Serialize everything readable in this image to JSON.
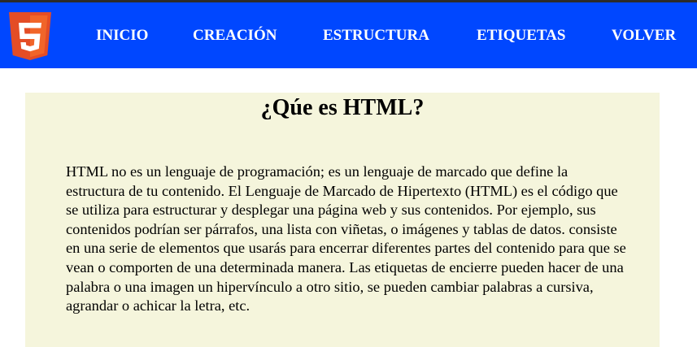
{
  "header": {
    "logo_icon": "html5-logo-icon",
    "logo_text": "5",
    "nav": [
      {
        "label": "INICIO"
      },
      {
        "label": "CREACIÓN"
      },
      {
        "label": "ESTRUCTURA"
      },
      {
        "label": "ETIQUETAS"
      },
      {
        "label": "VOLVER"
      }
    ]
  },
  "main": {
    "title": "¿Qúe es HTML?",
    "paragraph": "HTML no es un lenguaje de programación; es un lenguaje de marcado que define la estructura de tu contenido. El Lenguaje de Marcado de Hipertexto (HTML) es el código que se utiliza para estructurar y desplegar una página web y sus contenidos. Por ejemplo, sus contenidos podrían ser párrafos, una lista con viñetas, o imágenes y tablas de datos. consiste en una serie de elementos que usarás para encerrar diferentes partes del contenido para que se vean o comporten de una determinada manera. Las etiquetas de encierre pueden hacer de una palabra o una imagen un hipervínculo a otro sitio, se pueden cambiar palabras a cursiva, agrandar o achicar la letra, etc."
  },
  "colors": {
    "nav_background": "#0047ff",
    "content_background": "#f5f5dc",
    "logo_orange": "#e44d26",
    "logo_orange_light": "#f16529"
  }
}
